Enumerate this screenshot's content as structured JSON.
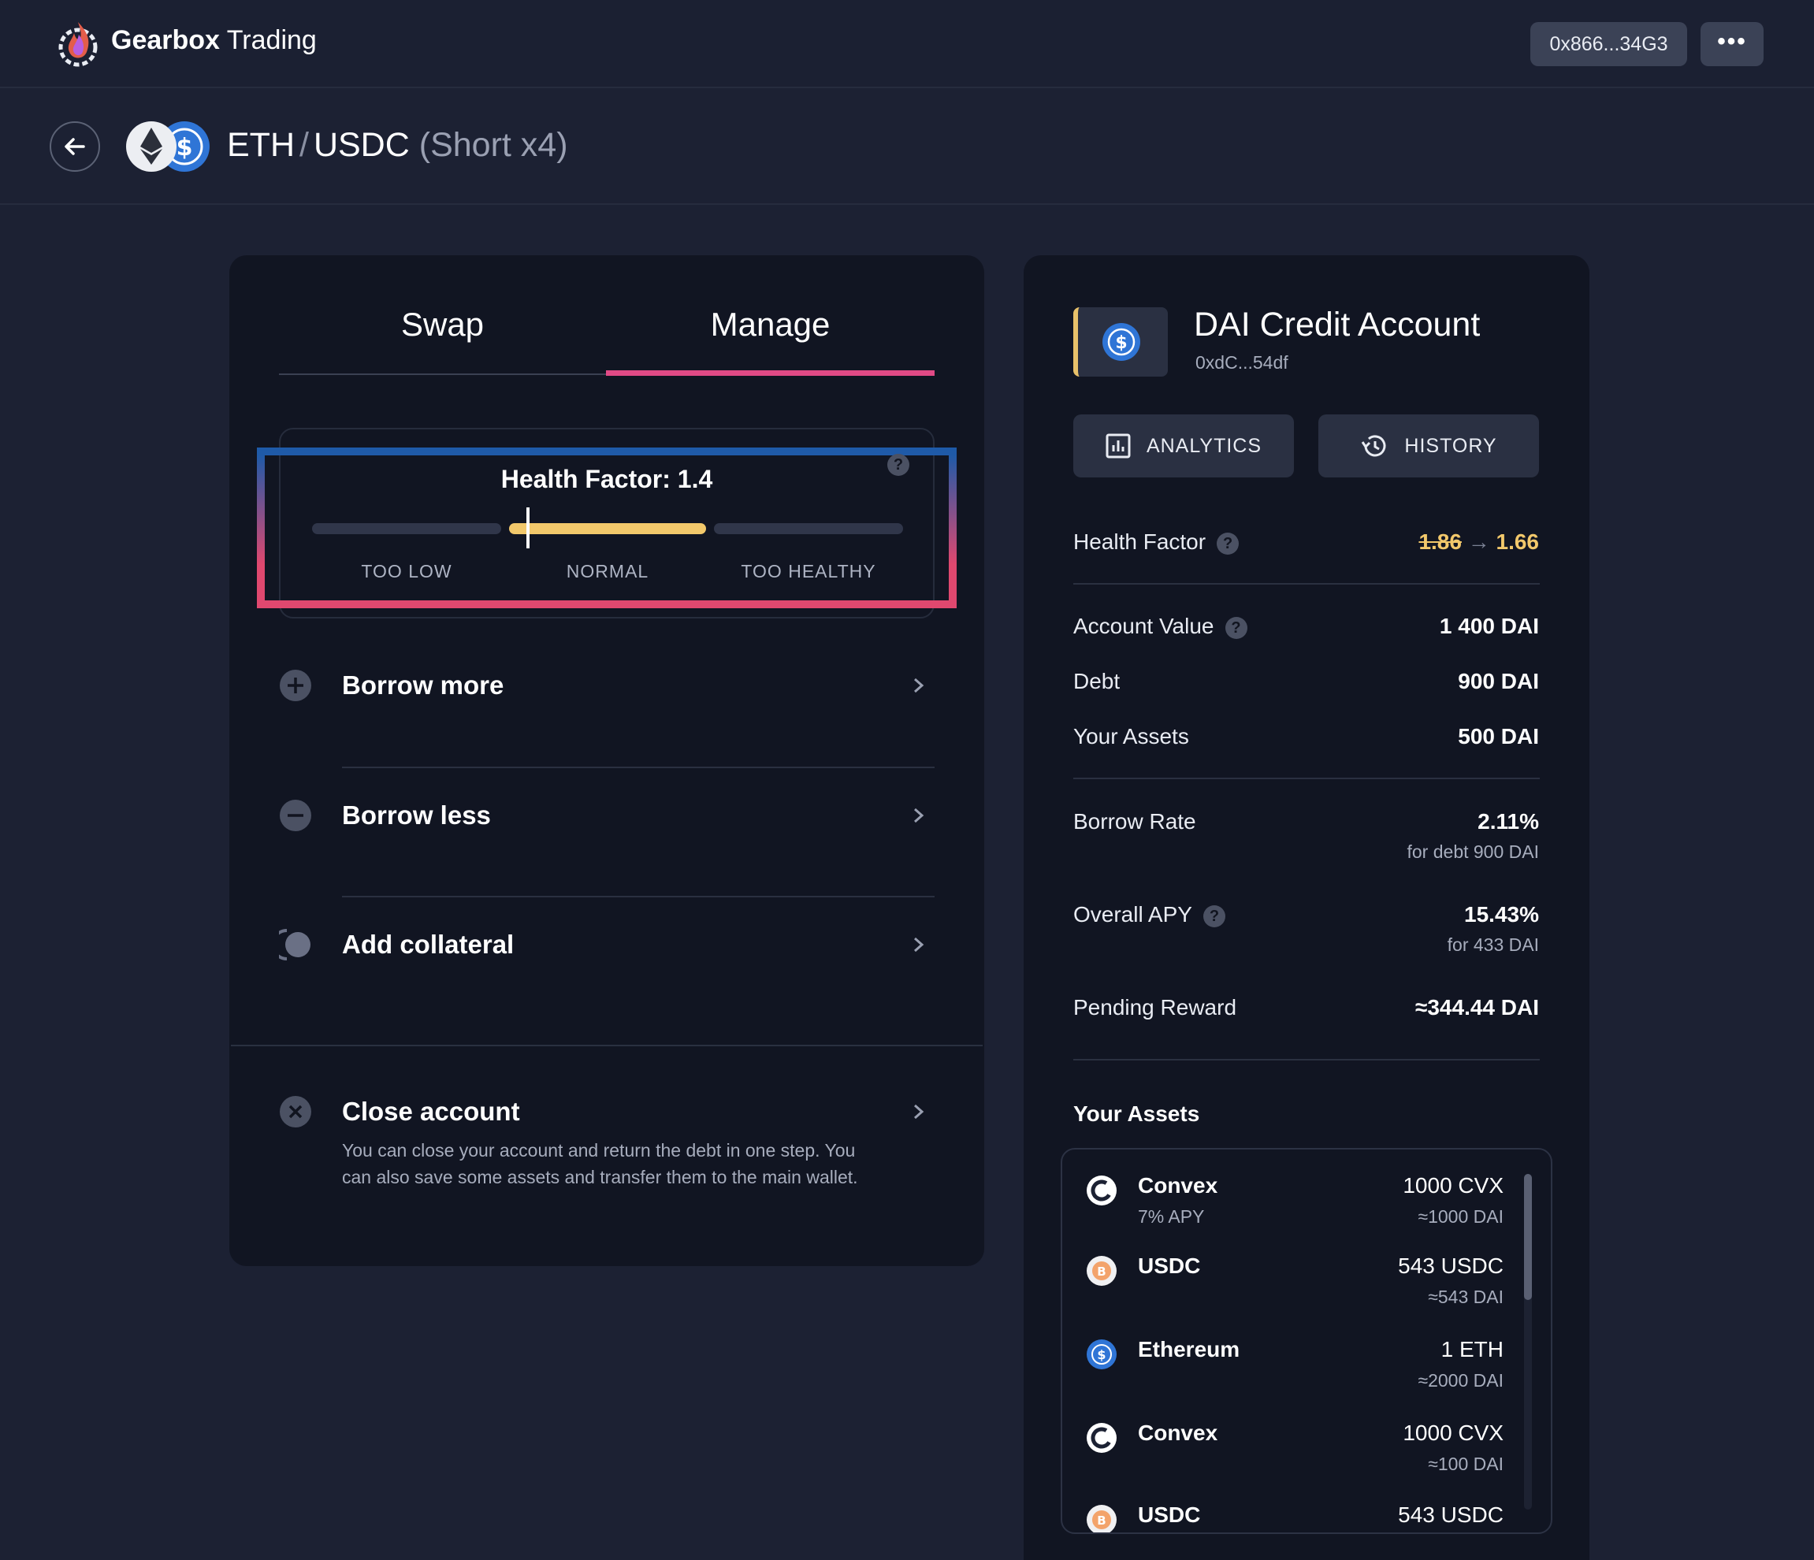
{
  "app": {
    "brand_bold": "Gearbox",
    "brand_rest": "Trading",
    "wallet_address": "0x866...34G3",
    "more_label": "•••"
  },
  "pair": {
    "base": "ETH",
    "separator": "/",
    "quote": "USDC",
    "mode": "(Short x4)"
  },
  "tabs": [
    {
      "label": "Swap",
      "active": false
    },
    {
      "label": "Manage",
      "active": true
    }
  ],
  "health_factor": {
    "title": "Health Factor: 1.4",
    "help": "?",
    "segments": [
      {
        "label": "TOO LOW"
      },
      {
        "label": "NORMAL"
      },
      {
        "label": "TOO HEALTHY"
      }
    ],
    "active_segment": "NORMAL",
    "value": 1.4
  },
  "actions": [
    {
      "label": "Borrow more",
      "icon": "plus-circle-icon"
    },
    {
      "label": "Borrow less",
      "icon": "minus-circle-icon"
    },
    {
      "label": "Add collateral",
      "icon": "collateral-icon"
    }
  ],
  "close_account": {
    "label": "Close account",
    "icon": "close-circle-icon",
    "description": "You can close your account and return the debt in one step. You can also save some assets and transfer them to the main wallet."
  },
  "account": {
    "title": "DAI Credit Account",
    "address": "0xdC...54df",
    "analytics_label": "ANALYTICS",
    "history_label": "HISTORY",
    "health_factor_label": "Health Factor",
    "health_factor_old": "1.86",
    "health_factor_new": "1.66",
    "account_value_label": "Account Value",
    "account_value": "1 400 DAI",
    "debt_label": "Debt",
    "debt": "900 DAI",
    "your_assets_label": "Your Assets",
    "your_assets": "500 DAI",
    "borrow_rate_label": "Borrow Rate",
    "borrow_rate": "2.11%",
    "borrow_rate_sub": "for debt 900 DAI",
    "overall_apy_label": "Overall APY",
    "overall_apy": "15.43%",
    "overall_apy_sub": "for 433 DAI",
    "pending_reward_label": "Pending Reward",
    "pending_reward": "≈344.44 DAI",
    "help": "?"
  },
  "assets_title": "Your Assets",
  "assets": [
    {
      "name": "Convex",
      "sub": "7% APY",
      "amount": "1000 CVX",
      "value": "≈1000 DAI",
      "icon": "convex-icon"
    },
    {
      "name": "USDC",
      "sub": "",
      "amount": "543 USDC",
      "value": "≈543 DAI",
      "icon": "bitcoin-icon"
    },
    {
      "name": "Ethereum",
      "sub": "",
      "amount": "1 ETH",
      "value": "≈2000 DAI",
      "icon": "usdc-icon"
    },
    {
      "name": "Convex",
      "sub": "",
      "amount": "1000 CVX",
      "value": "≈100 DAI",
      "icon": "convex-icon"
    },
    {
      "name": "USDC",
      "sub": "",
      "amount": "543 USDC",
      "value": "",
      "icon": "bitcoin-icon"
    }
  ],
  "colors": {
    "accent_pink": "#e14a86",
    "health_yellow": "#f2c86b",
    "bg": "#1c2133",
    "panel": "#111522"
  }
}
